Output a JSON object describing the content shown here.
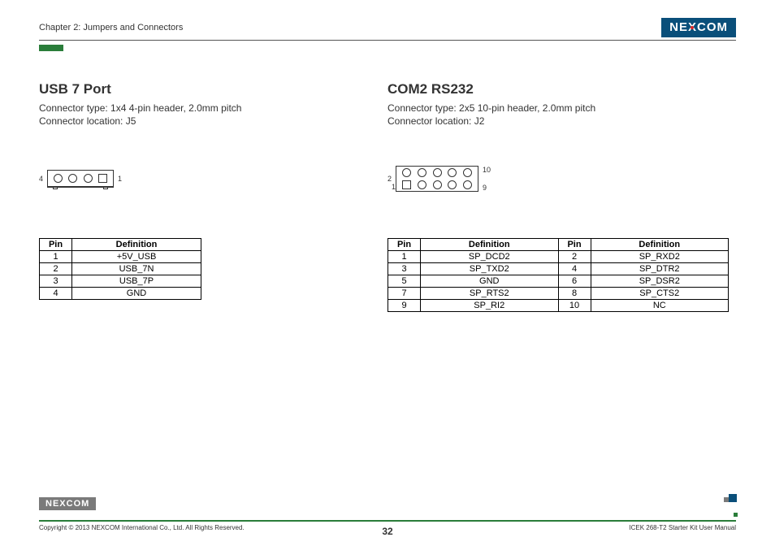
{
  "header": {
    "chapter": "Chapter 2: Jumpers and Connectors",
    "logo": "NEXCOM"
  },
  "left": {
    "title": "USB 7 Port",
    "desc_line1": "Connector type: 1x4 4-pin header, 2.0mm pitch",
    "desc_line2": "Connector location: J5",
    "pin_left": "4",
    "pin_right": "1",
    "th_pin": "Pin",
    "th_def": "Definition",
    "rows": [
      {
        "pin": "1",
        "def": "+5V_USB"
      },
      {
        "pin": "2",
        "def": "USB_7N"
      },
      {
        "pin": "3",
        "def": "USB_7P"
      },
      {
        "pin": "4",
        "def": "GND"
      }
    ]
  },
  "right": {
    "title": "COM2 RS232",
    "desc_line1": "Connector type: 2x5 10-pin header, 2.0mm pitch",
    "desc_line2": "Connector location: J2",
    "lbl_tl": "2",
    "lbl_tr": "10",
    "lbl_bl": "1",
    "lbl_br": "9",
    "th_pin": "Pin",
    "th_def": "Definition",
    "rows": [
      {
        "p1": "1",
        "d1": "SP_DCD2",
        "p2": "2",
        "d2": "SP_RXD2"
      },
      {
        "p1": "3",
        "d1": "SP_TXD2",
        "p2": "4",
        "d2": "SP_DTR2"
      },
      {
        "p1": "5",
        "d1": "GND",
        "p2": "6",
        "d2": "SP_DSR2"
      },
      {
        "p1": "7",
        "d1": "SP_RTS2",
        "p2": "8",
        "d2": "SP_CTS2"
      },
      {
        "p1": "9",
        "d1": "SP_RI2",
        "p2": "10",
        "d2": "NC"
      }
    ]
  },
  "footer": {
    "copyright": "Copyright © 2013 NEXCOM International Co., Ltd. All Rights Reserved.",
    "page": "32",
    "doc": "ICEK 268-T2 Starter Kit User Manual",
    "logo": "NEXCOM"
  }
}
